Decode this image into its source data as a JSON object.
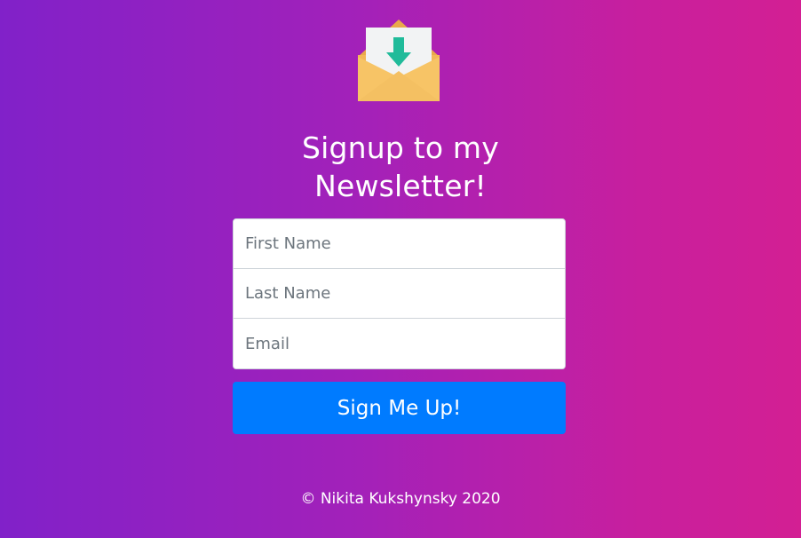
{
  "logo": {
    "icon": "envelope-download-icon"
  },
  "heading": {
    "line1": "Signup to my",
    "line2": "Newsletter!"
  },
  "form": {
    "first_name_placeholder": "First Name",
    "last_name_placeholder": "Last Name",
    "email_placeholder": "Email",
    "submit_label": "Sign Me Up!"
  },
  "footer": {
    "text": "© Nikita Kukshynsky 2020"
  },
  "colors": {
    "gradient_start": "#8121c9",
    "gradient_end": "#d31f93",
    "button": "#007bff",
    "envelope": "#f6c15b",
    "arrow": "#1fbf9c"
  }
}
